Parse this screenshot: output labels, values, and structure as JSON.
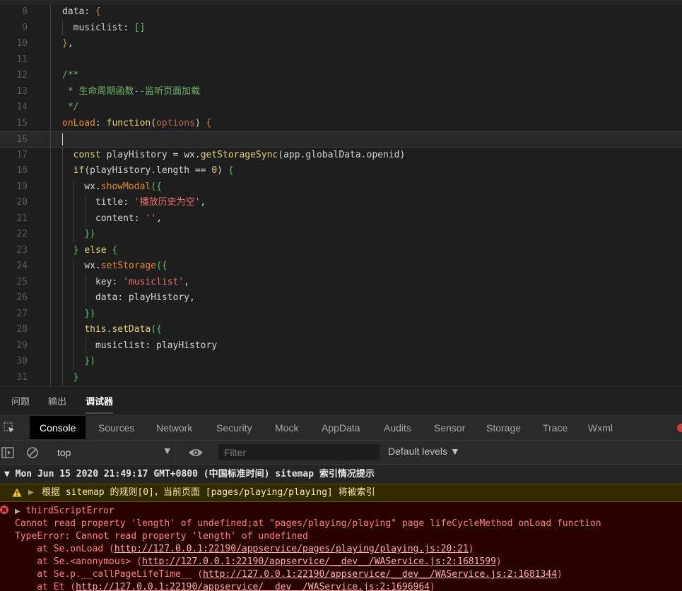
{
  "editor": {
    "lines": [
      {
        "num": "8",
        "tokens": [
          [
            "default",
            "data: "
          ],
          [
            "brace",
            "{"
          ]
        ]
      },
      {
        "num": "9",
        "tokens": [
          [
            "default",
            "  musiclist: "
          ],
          [
            "bracket",
            "[]"
          ]
        ]
      },
      {
        "num": "10",
        "tokens": [
          [
            "brace",
            "}"
          ],
          [
            "default",
            ","
          ]
        ]
      },
      {
        "num": "11",
        "tokens": []
      },
      {
        "num": "12",
        "tokens": [
          [
            "comment",
            "/**"
          ]
        ]
      },
      {
        "num": "13",
        "tokens": [
          [
            "comment",
            " * 生命周期函数--监听页面加载"
          ]
        ]
      },
      {
        "num": "14",
        "tokens": [
          [
            "comment",
            " */"
          ]
        ]
      },
      {
        "num": "15",
        "tokens": [
          [
            "orange",
            "onLoad"
          ],
          [
            "default",
            ": "
          ],
          [
            "keyword",
            "function"
          ],
          [
            "default",
            "("
          ],
          [
            "param",
            "options"
          ],
          [
            "default",
            ") "
          ],
          [
            "brace",
            "{"
          ]
        ]
      },
      {
        "num": "16",
        "tokens": [],
        "current": true
      },
      {
        "num": "17",
        "tokens": [
          [
            "default",
            "  "
          ],
          [
            "keyword",
            "const"
          ],
          [
            "default",
            " playHistory = wx."
          ],
          [
            "keyword",
            "getStorageSync"
          ],
          [
            "default",
            "(app.globalData.openid)"
          ]
        ]
      },
      {
        "num": "18",
        "tokens": [
          [
            "default",
            "  "
          ],
          [
            "keyword",
            "if"
          ],
          [
            "default",
            "(playHistory.length == "
          ],
          [
            "number",
            "0"
          ],
          [
            "default",
            ") "
          ],
          [
            "bracket",
            "{"
          ]
        ]
      },
      {
        "num": "19",
        "tokens": [
          [
            "default",
            "    wx."
          ],
          [
            "orange",
            "showModal"
          ],
          [
            "bracket",
            "({"
          ]
        ]
      },
      {
        "num": "20",
        "tokens": [
          [
            "default",
            "      title: "
          ],
          [
            "string",
            "'播放历史为空'"
          ],
          [
            "default",
            ","
          ]
        ]
      },
      {
        "num": "21",
        "tokens": [
          [
            "default",
            "      content: "
          ],
          [
            "string",
            "''"
          ],
          [
            "default",
            ","
          ]
        ]
      },
      {
        "num": "22",
        "tokens": [
          [
            "default",
            "    "
          ],
          [
            "bracket",
            "})"
          ]
        ]
      },
      {
        "num": "23",
        "tokens": [
          [
            "default",
            "  "
          ],
          [
            "bracket",
            "}"
          ],
          [
            "default",
            " "
          ],
          [
            "keyword",
            "else"
          ],
          [
            "default",
            " "
          ],
          [
            "bracket",
            "{"
          ]
        ]
      },
      {
        "num": "24",
        "tokens": [
          [
            "default",
            "    wx."
          ],
          [
            "orange",
            "setStorage"
          ],
          [
            "bracket",
            "({"
          ]
        ]
      },
      {
        "num": "25",
        "tokens": [
          [
            "default",
            "      key: "
          ],
          [
            "string",
            "'musiclist'"
          ],
          [
            "default",
            ","
          ]
        ]
      },
      {
        "num": "26",
        "tokens": [
          [
            "default",
            "      data: playHistory,"
          ]
        ]
      },
      {
        "num": "27",
        "tokens": [
          [
            "default",
            "    "
          ],
          [
            "bracket",
            "})"
          ]
        ]
      },
      {
        "num": "28",
        "tokens": [
          [
            "default",
            "    "
          ],
          [
            "keyword",
            "this"
          ],
          [
            "default",
            "."
          ],
          [
            "keyword",
            "setData"
          ],
          [
            "bracket",
            "({"
          ]
        ]
      },
      {
        "num": "29",
        "tokens": [
          [
            "default",
            "      musiclist: playHistory"
          ]
        ]
      },
      {
        "num": "30",
        "tokens": [
          [
            "default",
            "    "
          ],
          [
            "bracket",
            "})"
          ]
        ]
      },
      {
        "num": "31",
        "tokens": [
          [
            "default",
            "  "
          ],
          [
            "bracket",
            "}"
          ]
        ]
      }
    ]
  },
  "panel_tabs": [
    "问题",
    "输出",
    "调试器"
  ],
  "panel_active": 2,
  "devtools_tabs": [
    "Console",
    "Sources",
    "Network",
    "Security",
    "Mock",
    "AppData",
    "Audits",
    "Sensor",
    "Storage",
    "Trace",
    "Wxml"
  ],
  "devtools_active": 0,
  "toolbar": {
    "context": "top",
    "filter_placeholder": "Filter",
    "levels": "Default levels ▼"
  },
  "console": {
    "group_header": "▼ Mon Jun 15 2020 21:49:17 GMT+0800 (中国标准时间) sitemap 索引情况提示",
    "warning_text": "根据 sitemap 的规则[0]，当前页面 [pages/playing/playing] 将被索引",
    "error_title": "thirdScriptError",
    "error_message": "Cannot read property 'length' of undefined;at \"pages/playing/playing\" page lifeCycleMethod onLoad function",
    "error_type": "TypeError: Cannot read property 'length' of undefined",
    "stack": [
      {
        "prefix": "    at Se.onLoad (",
        "link": "http://127.0.0.1:22190/appservice/pages/playing/playing.js:20:21",
        "suffix": ")"
      },
      {
        "prefix": "    at Se.<anonymous> (",
        "link": "http://127.0.0.1:22190/appservice/__dev__/WAService.js:2:1681599",
        "suffix": ")"
      },
      {
        "prefix": "    at Se.p.__callPageLifeTime__ (",
        "link": "http://127.0.0.1:22190/appservice/__dev__/WAService.js:2:1681344",
        "suffix": ")"
      },
      {
        "prefix": "    at Et (",
        "link": "http://127.0.0.1:22190/appservice/__dev__/WAService.js:2:1696964",
        "suffix": ")"
      }
    ]
  }
}
